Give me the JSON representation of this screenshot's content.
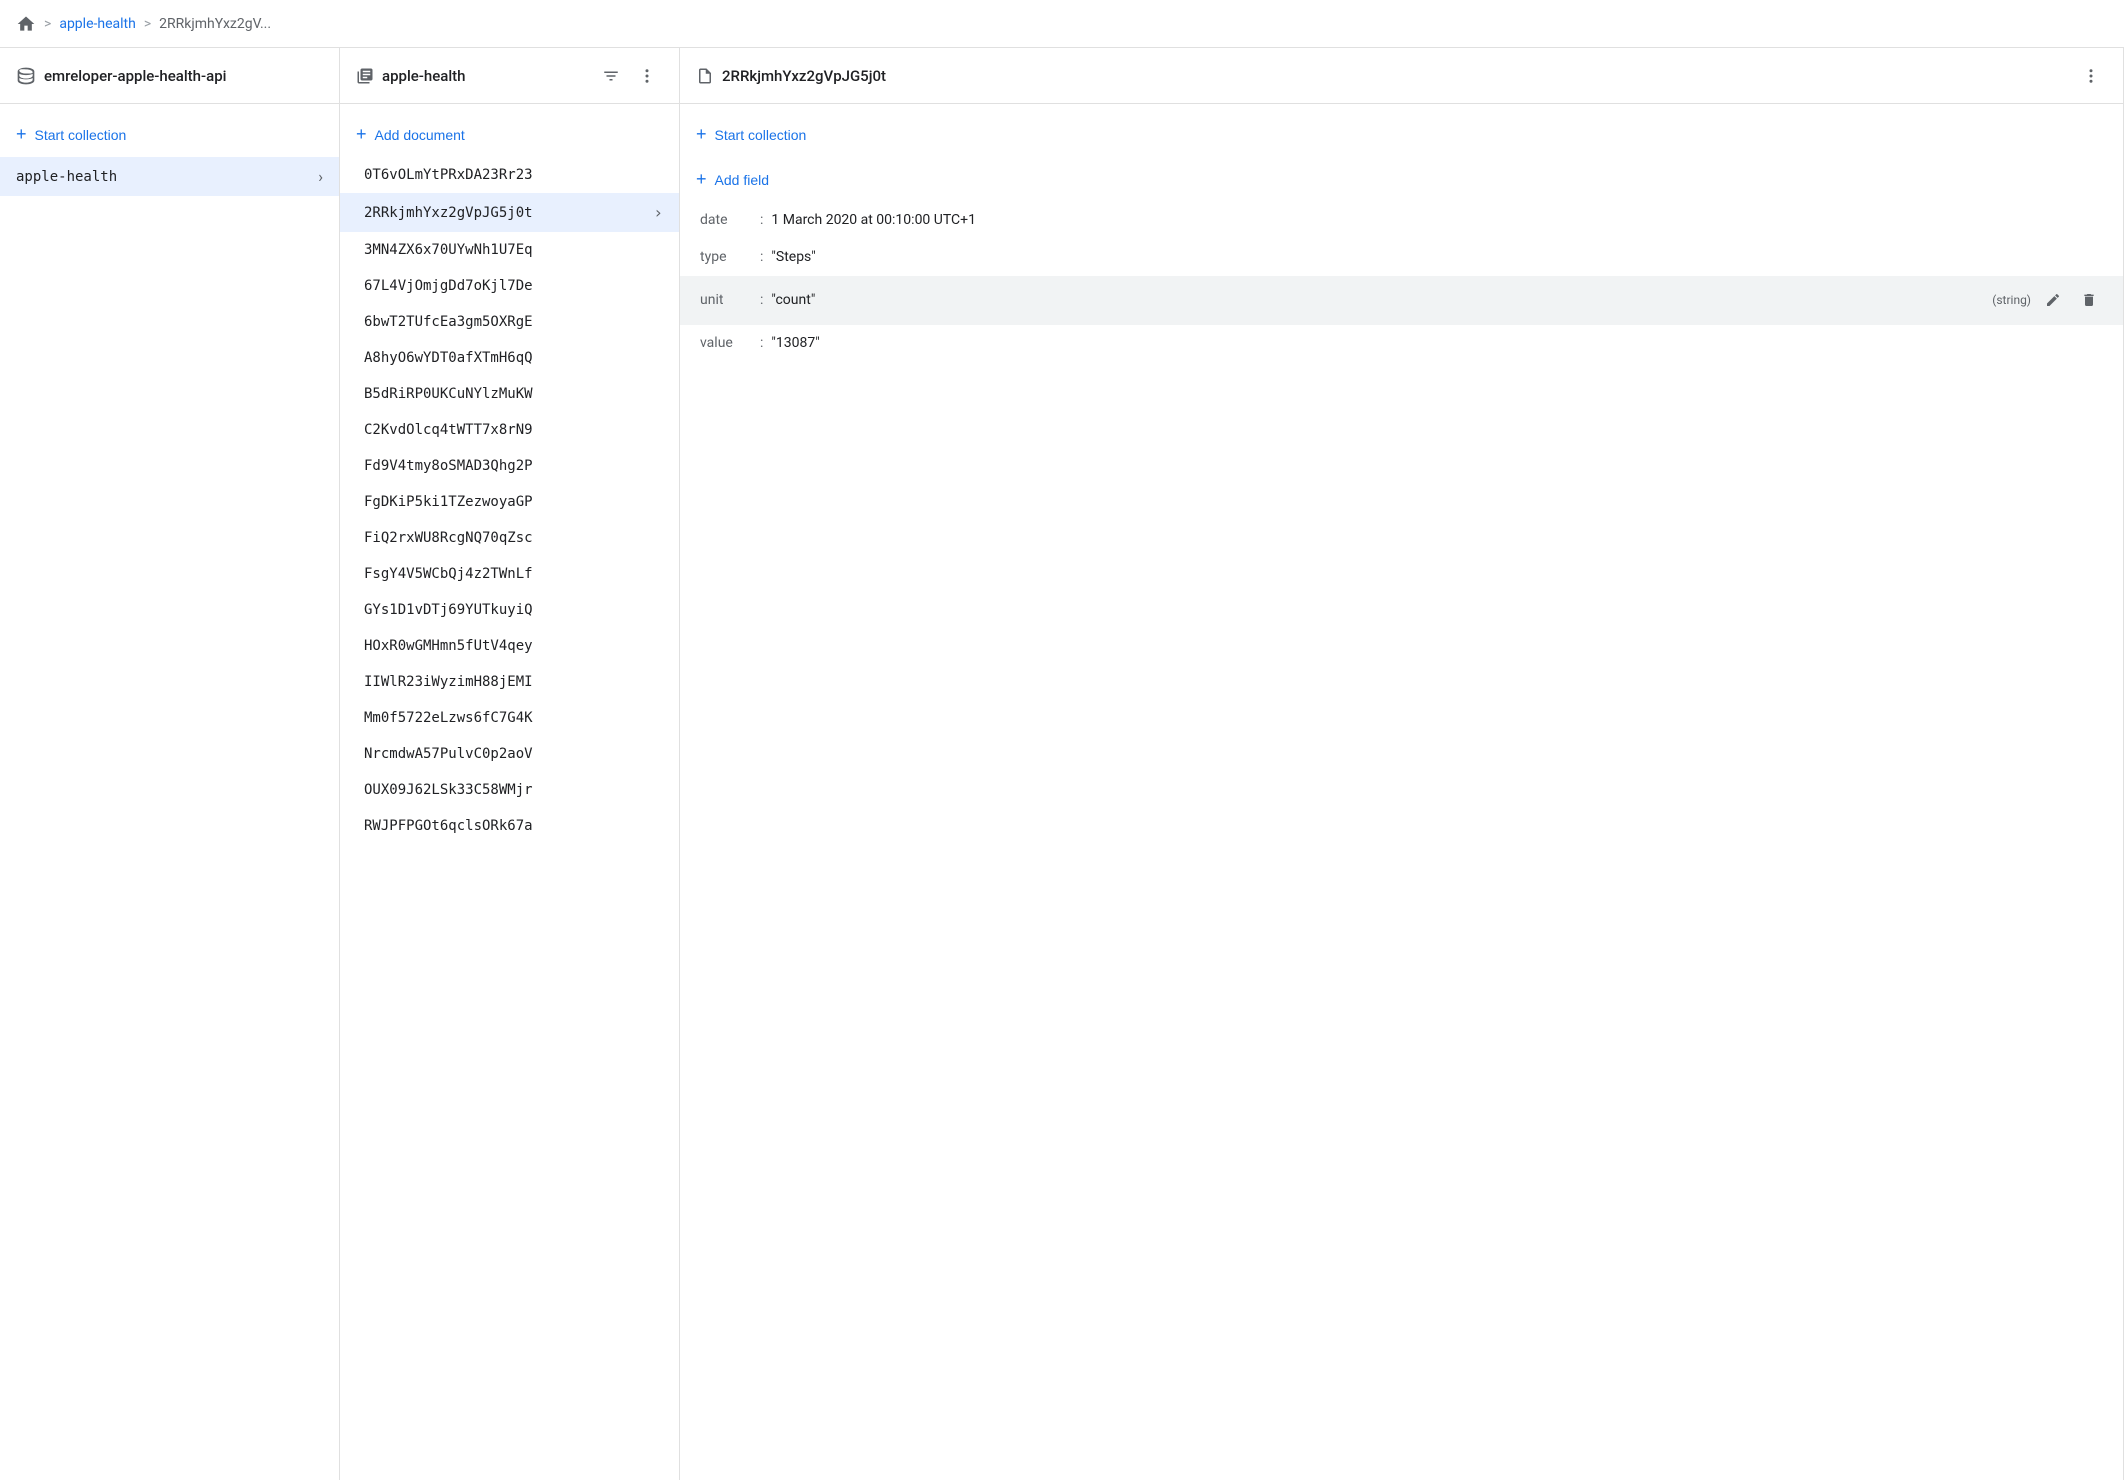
{
  "breadcrumb": {
    "home_label": "home",
    "sep1": ">",
    "link1": "apple-health",
    "sep2": ">",
    "current": "2RRkjmhYxz2gV..."
  },
  "left_panel": {
    "header": "emreloper-apple-health-api",
    "start_collection_label": "Start collection",
    "collection_item": "apple-health"
  },
  "middle_panel": {
    "header": "apple-health",
    "add_document_label": "Add document",
    "documents": [
      "0T6vOLmYtPRxDA23Rr23",
      "2RRkjmhYxz2gVpJG5j0t",
      "3MN4ZX6x70UYwNh1U7Eq",
      "67L4VjOmjgDd7oKjl7De",
      "6bwT2TUfcEa3gm5OXRgE",
      "A8hyO6wYDT0afXTmH6qQ",
      "B5dRiRP0UKCuNYlzMuKW",
      "C2KvdOlcq4tWTT7x8rN9",
      "Fd9V4tmy8oSMAD3Qhg2P",
      "FgDKiP5ki1TZezwoyaGP",
      "FiQ2rxWU8RcgNQ70qZsc",
      "FsgY4V5WCbQj4z2TWnLf",
      "GYs1D1vDTj69YUTkuyiQ",
      "HOxR0wGMHmn5fUtV4qey",
      "IIWlR23iWyzimH88jEMI",
      "Mm0f5722eLzws6fC7G4K",
      "NrcmdwA57PulvC0p2aoV",
      "OUX09J62LSk33C58WMjr",
      "RWJPFPGOt6qclsORk67a"
    ],
    "selected_doc": "2RRkjmhYxz2gVpJG5j0t"
  },
  "right_panel": {
    "header": "2RRkjmhYxz2gVpJG5j0t",
    "start_collection_label": "Start collection",
    "add_field_label": "Add field",
    "fields": [
      {
        "key": "date",
        "value": "1 March 2020 at 00:10:00 UTC+1",
        "type": "",
        "highlighted": false
      },
      {
        "key": "type",
        "value": "\"Steps\"",
        "type": "",
        "highlighted": false
      },
      {
        "key": "unit",
        "value": "\"count\"",
        "type": "string",
        "highlighted": true
      },
      {
        "key": "value",
        "value": "\"13087\"",
        "type": "",
        "highlighted": false
      }
    ]
  }
}
